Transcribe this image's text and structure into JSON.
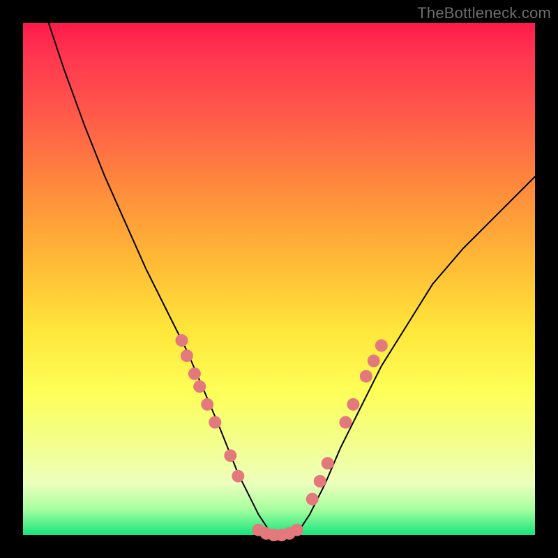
{
  "watermark": "TheBottleneck.com",
  "chart_data": {
    "type": "line",
    "title": "",
    "xlabel": "",
    "ylabel": "",
    "xlim": [
      0,
      100
    ],
    "ylim": [
      0,
      100
    ],
    "grid": false,
    "legend": false,
    "series": [
      {
        "name": "bottleneck-curve",
        "x": [
          5,
          8,
          12,
          16,
          20,
          24,
          28,
          32,
          35,
          38,
          40,
          42,
          44,
          46,
          48,
          50,
          52,
          54,
          56,
          59,
          62,
          66,
          70,
          75,
          80,
          86,
          92,
          100
        ],
        "y": [
          100,
          91,
          80,
          70,
          61,
          52,
          44,
          36,
          29,
          22,
          17,
          12,
          8,
          4,
          1,
          0,
          0,
          1,
          4,
          10,
          17,
          25,
          33,
          41,
          49,
          56,
          62,
          70
        ]
      }
    ],
    "markers": {
      "name": "sample-dots",
      "color": "#e4797d",
      "radius_px": 9,
      "points": [
        {
          "x": 31.0,
          "y": 38.0
        },
        {
          "x": 32.0,
          "y": 35.0
        },
        {
          "x": 33.5,
          "y": 31.5
        },
        {
          "x": 34.5,
          "y": 29.0
        },
        {
          "x": 36.0,
          "y": 25.5
        },
        {
          "x": 37.5,
          "y": 22.0
        },
        {
          "x": 40.5,
          "y": 15.5
        },
        {
          "x": 42.0,
          "y": 11.5
        },
        {
          "x": 46.0,
          "y": 1.0
        },
        {
          "x": 47.5,
          "y": 0.3
        },
        {
          "x": 49.0,
          "y": 0.0
        },
        {
          "x": 50.5,
          "y": 0.0
        },
        {
          "x": 52.0,
          "y": 0.3
        },
        {
          "x": 53.5,
          "y": 1.0
        },
        {
          "x": 56.5,
          "y": 7.0
        },
        {
          "x": 58.0,
          "y": 10.5
        },
        {
          "x": 59.5,
          "y": 14.0
        },
        {
          "x": 63.0,
          "y": 22.0
        },
        {
          "x": 64.5,
          "y": 25.5
        },
        {
          "x": 67.0,
          "y": 31.0
        },
        {
          "x": 68.5,
          "y": 34.0
        },
        {
          "x": 70.0,
          "y": 37.0
        }
      ]
    }
  }
}
